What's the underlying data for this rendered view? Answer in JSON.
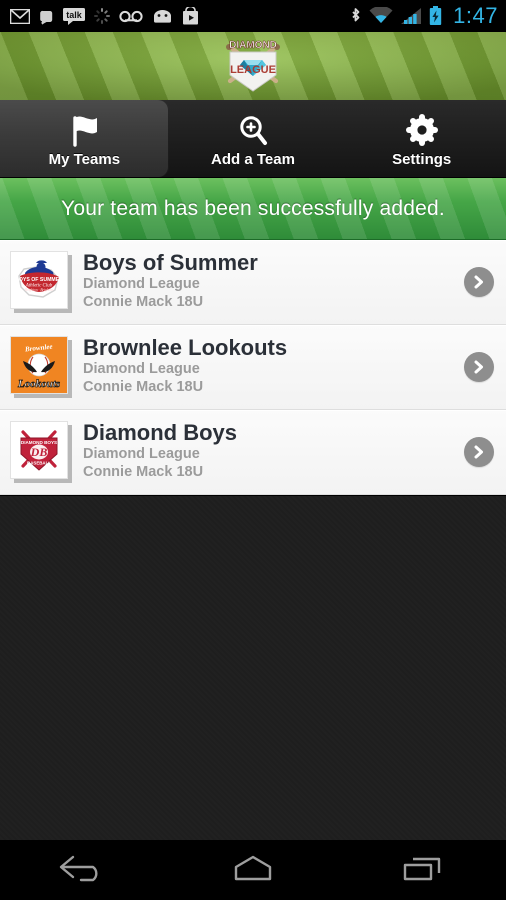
{
  "statusbar": {
    "time": "1:47",
    "left_icons": [
      "gmail-icon",
      "evernote-icon",
      "talk-icon",
      "sync-spinner-icon",
      "voicemail-icon",
      "android-icon",
      "play-store-icon"
    ],
    "right_icons": [
      "bluetooth-icon",
      "wifi-icon",
      "cell-signal-icon",
      "battery-charging-icon"
    ],
    "accent_color": "#33b5e5"
  },
  "header": {
    "logo_title": "DIAMOND",
    "logo_subtitle": "LEAGUE",
    "background": "baseball-grass-field"
  },
  "tabs": [
    {
      "label": "My Teams",
      "icon": "flag-icon",
      "selected": true
    },
    {
      "label": "Add a Team",
      "icon": "search-plus-icon",
      "selected": false
    },
    {
      "label": "Settings",
      "icon": "gear-icon",
      "selected": false
    }
  ],
  "banner": {
    "message": "Your team has been successfully added.",
    "color": "#46a647"
  },
  "teams": [
    {
      "name": "Boys of Summer",
      "league": "Diamond League",
      "division": "Connie Mack 18U",
      "logo": "boys-of-summer-athletic-club-logo",
      "logo_colors": {
        "primary": "#c3272f",
        "secondary": "#1f3a93",
        "background": "#ffffff"
      }
    },
    {
      "name": "Brownlee Lookouts",
      "league": "Diamond League",
      "division": "Connie Mack 18U",
      "logo": "brownlee-lookouts-logo",
      "logo_colors": {
        "primary": "#f08522",
        "secondary": "#ffffff",
        "background": "#f08522"
      }
    },
    {
      "name": "Diamond Boys",
      "league": "Diamond League",
      "division": "Connie Mack 18U",
      "logo": "diamond-boys-baseball-logo",
      "logo_colors": {
        "primary": "#c0223b",
        "secondary": "#ffffff",
        "background": "#ffffff"
      }
    }
  ],
  "navbar": [
    {
      "label": "Back",
      "icon": "back-arrow-icon"
    },
    {
      "label": "Home",
      "icon": "home-icon"
    },
    {
      "label": "Recent Apps",
      "icon": "recent-apps-icon"
    }
  ]
}
